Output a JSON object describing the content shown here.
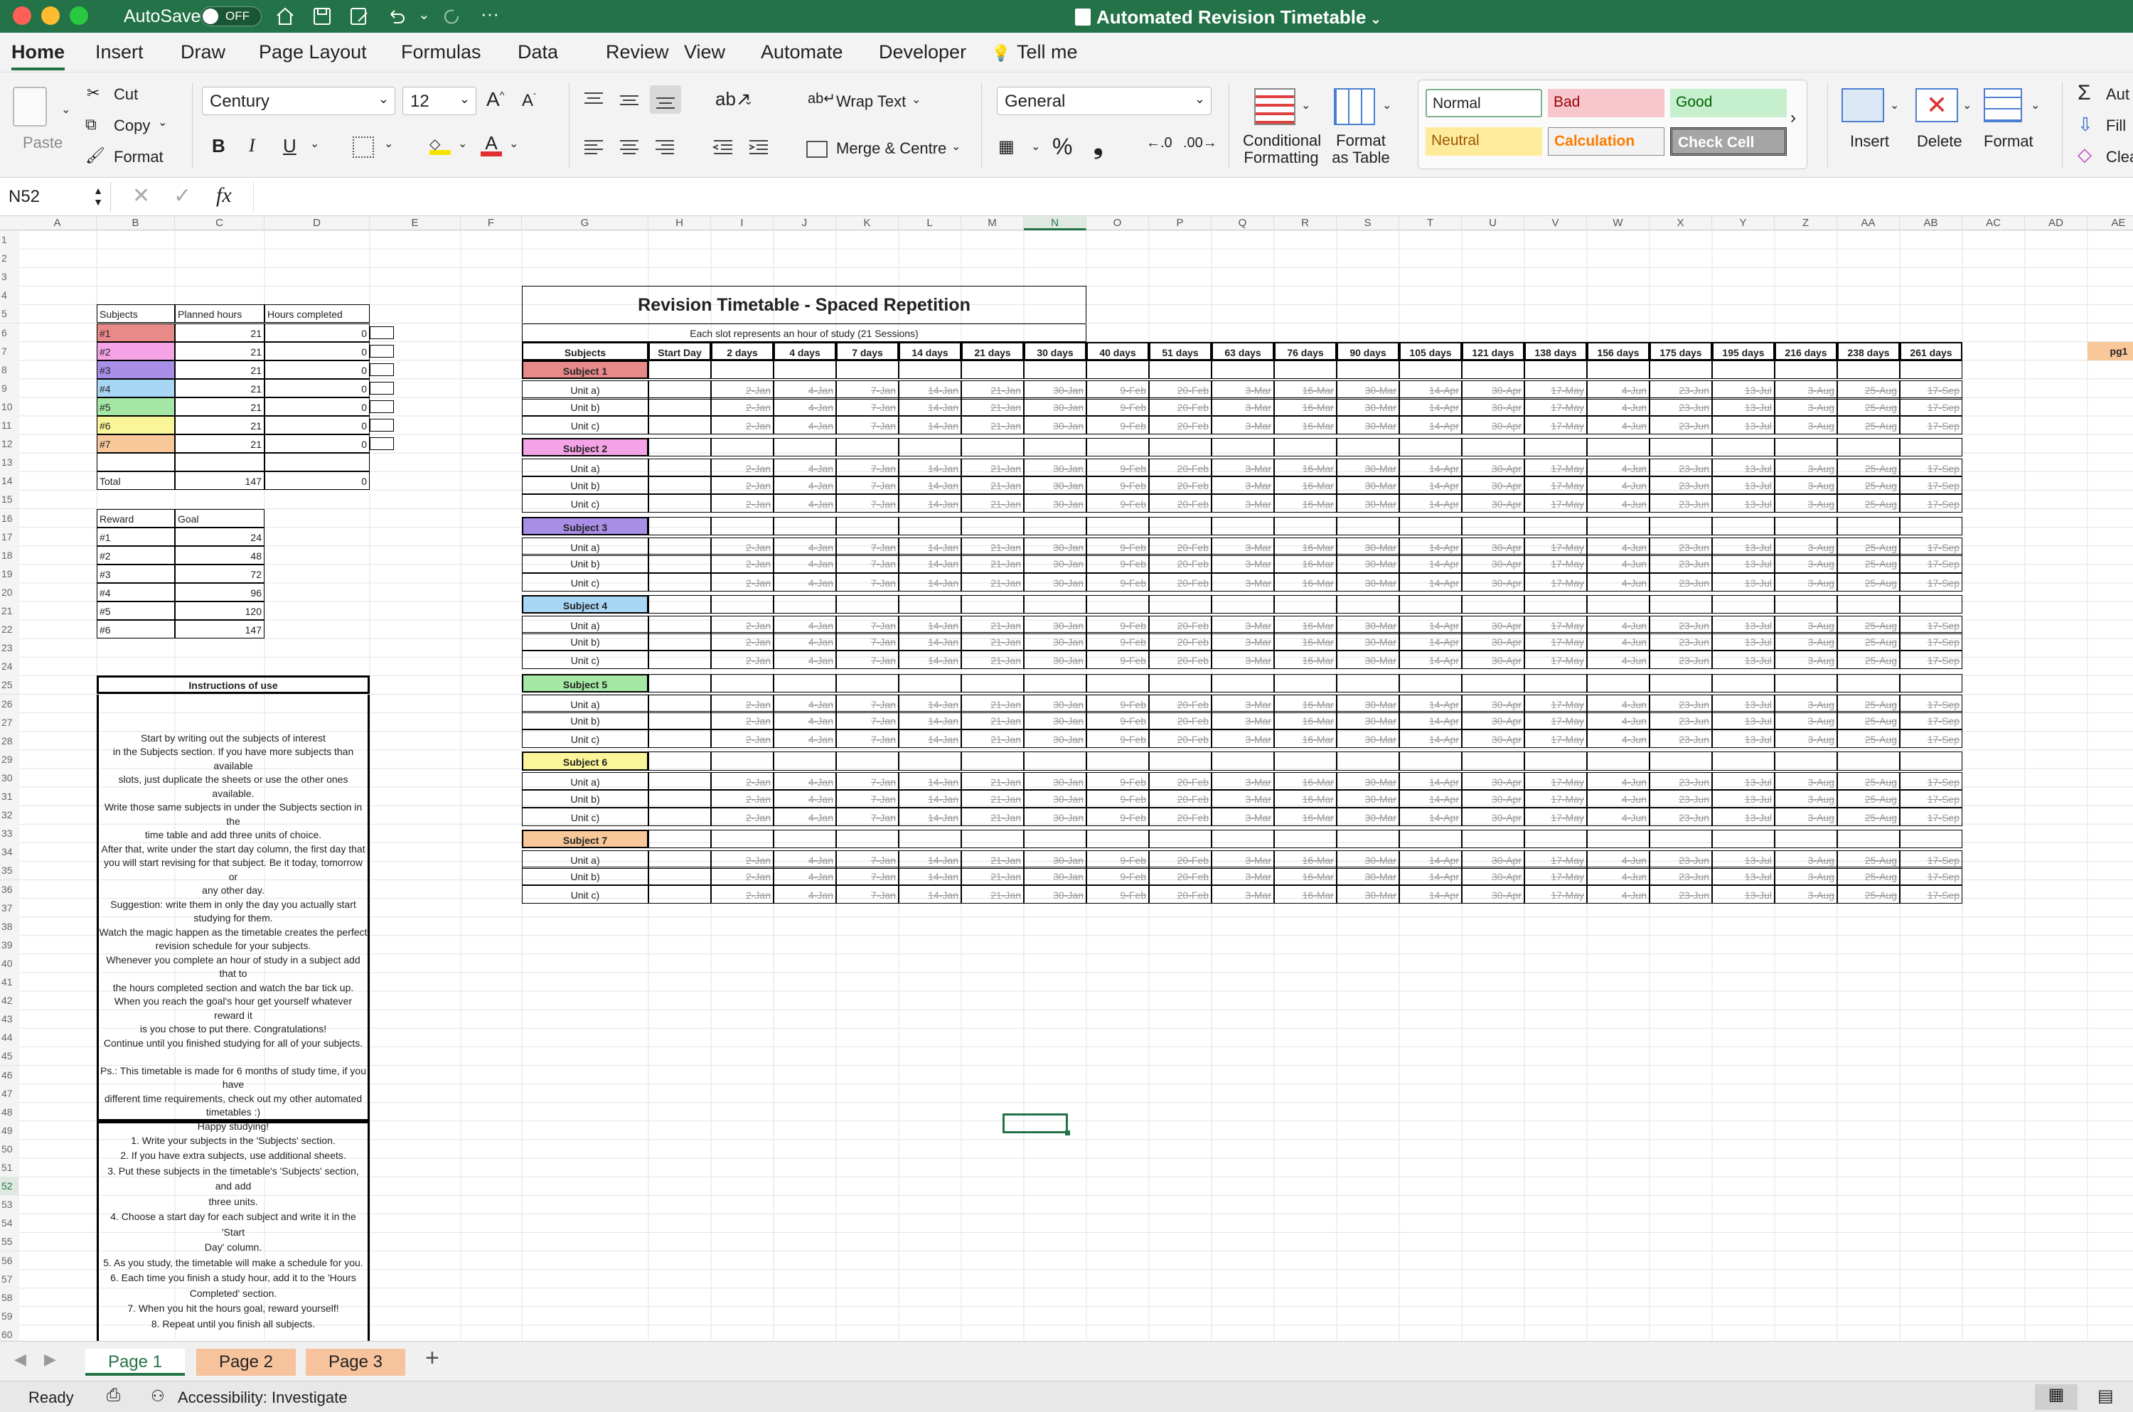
{
  "window": {
    "title": "Automated Revision Timetable",
    "autosave_label": "AutoSave",
    "autosave_state": "OFF"
  },
  "ribbon_tabs": [
    "Home",
    "Insert",
    "Draw",
    "Page Layout",
    "Formulas",
    "Data",
    "Review",
    "View",
    "Automate",
    "Developer",
    "Tell me"
  ],
  "clipboard": {
    "paste": "Paste",
    "cut": "Cut",
    "copy": "Copy",
    "format": "Format"
  },
  "font": {
    "name": "Century",
    "size": "12",
    "bold": "B",
    "italic": "I",
    "underline": "U"
  },
  "alignment": {
    "wrap": "Wrap Text",
    "merge": "Merge & Centre"
  },
  "number": {
    "format": "General",
    "percent": "%",
    "comma": "❟"
  },
  "styles": {
    "conditional": [
      "Conditional",
      "Formatting"
    ],
    "format_table": [
      "Format",
      "as Table"
    ],
    "cells": [
      {
        "label": "Normal",
        "bg": "#ffffff",
        "fg": "#222222"
      },
      {
        "label": "Bad",
        "bg": "#f8c7ce",
        "fg": "#9c0006"
      },
      {
        "label": "Good",
        "bg": "#c6efce",
        "fg": "#006100"
      },
      {
        "label": "Neutral",
        "bg": "#ffeb9c",
        "fg": "#9c5700"
      },
      {
        "label": "Calculation",
        "bg": "#f2f2f2",
        "fg": "#fa7d00"
      },
      {
        "label": "Check Cell",
        "bg": "#a5a5a5",
        "fg": "#ffffff"
      }
    ]
  },
  "cells_group": {
    "insert": "Insert",
    "delete": "Delete",
    "format": "Format"
  },
  "editing": {
    "autosum": "Aut",
    "fill": "Fill",
    "clear": "Clea"
  },
  "formula_bar": {
    "name_box": "N52",
    "fx": "fx",
    "value": ""
  },
  "columns": [
    "A",
    "B",
    "C",
    "D",
    "E",
    "F",
    "G",
    "H",
    "I",
    "J",
    "K",
    "L",
    "M",
    "N",
    "O",
    "P",
    "Q",
    "R",
    "S",
    "T",
    "U",
    "V",
    "W",
    "X",
    "Y",
    "Z",
    "AA",
    "AB",
    "AC",
    "AD",
    "AE"
  ],
  "row_count": 66,
  "subjects_table": {
    "headers": [
      "Subjects",
      "Planned hours",
      "Hours completed"
    ],
    "rows": [
      {
        "name": "#1",
        "planned": "21",
        "completed": "0",
        "color": "#e88a8a"
      },
      {
        "name": "#2",
        "planned": "21",
        "completed": "0",
        "color": "#f4a4e6"
      },
      {
        "name": "#3",
        "planned": "21",
        "completed": "0",
        "color": "#a98ee8"
      },
      {
        "name": "#4",
        "planned": "21",
        "completed": "0",
        "color": "#a8d6f5"
      },
      {
        "name": "#5",
        "planned": "21",
        "completed": "0",
        "color": "#a5e8a5"
      },
      {
        "name": "#6",
        "planned": "21",
        "completed": "0",
        "color": "#fbf59a"
      },
      {
        "name": "#7",
        "planned": "21",
        "completed": "0",
        "color": "#f8c79a"
      }
    ],
    "total_label": "Total",
    "total_planned": "147",
    "total_completed": "0"
  },
  "reward_table": {
    "headers": [
      "Reward",
      "Goal"
    ],
    "rows": [
      [
        "#1",
        "24"
      ],
      [
        "#2",
        "48"
      ],
      [
        "#3",
        "72"
      ],
      [
        "#4",
        "96"
      ],
      [
        "#5",
        "120"
      ],
      [
        "#6",
        "147"
      ]
    ]
  },
  "instructions": {
    "title": "Instructions of use",
    "body": [
      "Start by writing out the subjects of interest",
      "in the Subjects section. If you have more subjects than available",
      "slots, just duplicate the sheets or use the other ones available.",
      "Write those same subjects in under the Subjects section in the",
      "time table and add three units of choice.",
      "After that, write under the start day column, the first day that",
      "you will start revising for that subject. Be it today, tomorrow or",
      "any other day.",
      "Suggestion: write them in only the day you actually start",
      "studying for them.",
      "Watch the magic happen as the timetable creates the perfect",
      "revision schedule for your subjects.",
      "Whenever you complete an hour of study in a subject add that to",
      "the hours completed section and watch the bar tick up.",
      "When you reach the goal's hour get yourself whatever reward it",
      "is you chose to put there. Congratulations!",
      "Continue until you finished studying for all of your subjects.",
      "",
      "Ps.: This timetable is made for 6 months of study time, if you have",
      "different time requirements, check out my other automated",
      "timetables :)",
      "Happy studying!"
    ],
    "steps": [
      "1. Write your subjects in the 'Subjects' section.",
      "2. If you have extra subjects, use additional sheets.",
      "3. Put these subjects in the timetable's 'Subjects' section, and add",
      "three units.",
      "4. Choose a start day for each subject and write it in the 'Start",
      "Day' column.",
      "5. As you study, the timetable will make a schedule for you.",
      "6. Each time you finish a study hour, add it to the 'Hours",
      "Completed' section.",
      "7. When you hit the hours goal, reward yourself!",
      "8. Repeat until you finish all subjects."
    ]
  },
  "timetable": {
    "title": "Revision Timetable - Spaced Repetition",
    "subtitle": "Each slot represents an hour of study (21 Sessions)",
    "headers": [
      "Subjects",
      "Start Day",
      "2 days",
      "4 days",
      "7 days",
      "14 days",
      "21 days",
      "30 days",
      "40 days",
      "51 days",
      "63 days",
      "76 days",
      "90 days",
      "105 days",
      "121 days",
      "138 days",
      "156 days",
      "175 days",
      "195 days",
      "216 days",
      "238 days",
      "261 days"
    ],
    "dates": [
      "2-Jan",
      "4-Jan",
      "7-Jan",
      "14-Jan",
      "21-Jan",
      "30-Jan",
      "9-Feb",
      "20-Feb",
      "3-Mar",
      "16-Mar",
      "30-Mar",
      "14-Apr",
      "30-Apr",
      "17-May",
      "4-Jun",
      "23-Jun",
      "13-Jul",
      "3-Aug",
      "25-Aug",
      "17-Sep"
    ],
    "subjects": [
      {
        "name": "Subject 1",
        "color": "#e88a8a"
      },
      {
        "name": "Subject 2",
        "color": "#f4a4e6"
      },
      {
        "name": "Subject 3",
        "color": "#a98ee8"
      },
      {
        "name": "Subject 4",
        "color": "#a8d6f5"
      },
      {
        "name": "Subject 5",
        "color": "#a5e8a5"
      },
      {
        "name": "Subject 6",
        "color": "#fbf59a"
      },
      {
        "name": "Subject 7",
        "color": "#f8c79a"
      }
    ],
    "units": [
      "Unit a)",
      "Unit b)",
      "Unit c)"
    ]
  },
  "pg_label": "pg1",
  "sheet_tabs": [
    "Page 1",
    "Page 2",
    "Page 3"
  ],
  "status": {
    "ready": "Ready",
    "accessibility": "Accessibility: Investigate"
  }
}
